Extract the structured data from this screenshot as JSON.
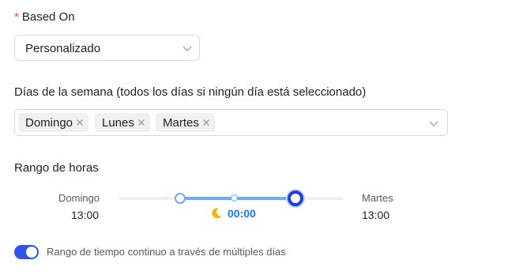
{
  "based_on": {
    "required_mark": "*",
    "label": "Based On",
    "selected": "Personalizado"
  },
  "weekdays": {
    "label": "Días de la semana (todos los días si ningún día está seleccionado)",
    "tags": [
      "Domingo",
      "Lunes",
      "Martes"
    ]
  },
  "hour_range": {
    "label": "Rango de horas",
    "start_day": "Domingo",
    "start_time": "13:00",
    "mid_time": "00:00",
    "mid_icon": "moon-icon",
    "end_day": "Martes",
    "end_time": "13:00",
    "accent_color": "#1677ff",
    "handle_color": "#1f3fe0"
  },
  "continuous_toggle": {
    "on": true,
    "label": "Rango de tiempo continuo a través de múltiples días"
  }
}
